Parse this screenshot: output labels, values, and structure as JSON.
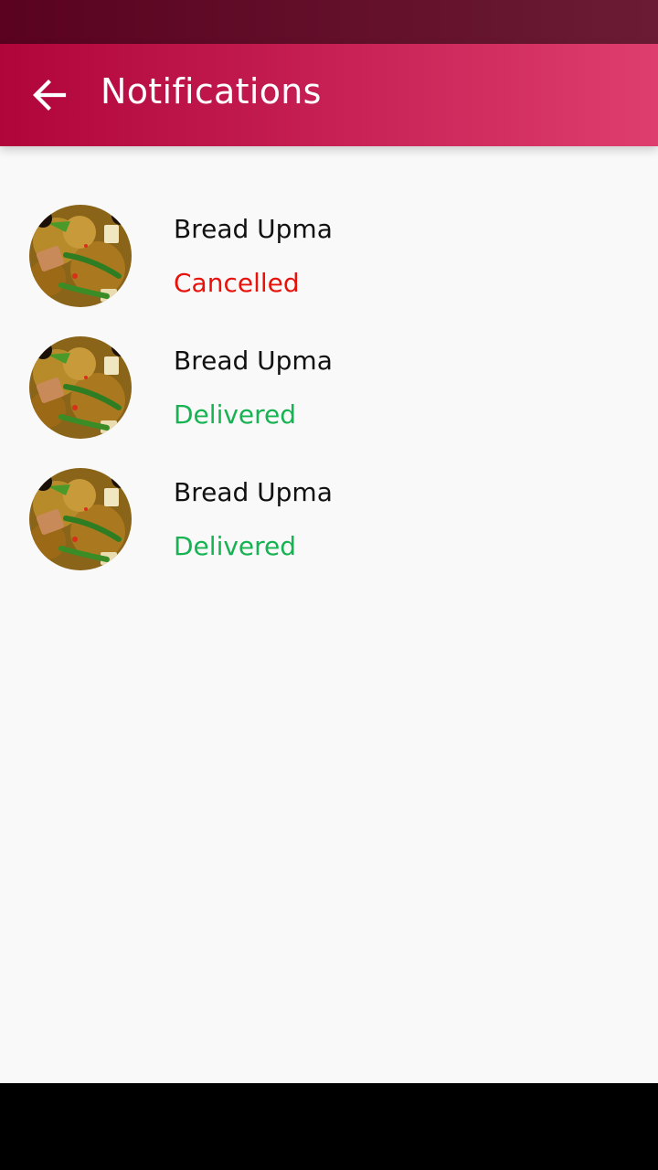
{
  "header": {
    "title": "Notifications",
    "back_icon": "arrow-left-icon"
  },
  "colors": {
    "app_bar_start": "#b0053a",
    "app_bar_end": "#de3e6d",
    "status_bar": "#5a0220",
    "cancelled": "#e8120c",
    "delivered": "#16b352"
  },
  "notifications": [
    {
      "title": "Bread Upma",
      "status": "Cancelled",
      "status_color": "#e8120c",
      "image": "food-thumbnail"
    },
    {
      "title": "Bread Upma",
      "status": "Delivered",
      "status_color": "#16b352",
      "image": "food-thumbnail"
    },
    {
      "title": "Bread Upma",
      "status": "Delivered",
      "status_color": "#16b352",
      "image": "food-thumbnail"
    }
  ]
}
